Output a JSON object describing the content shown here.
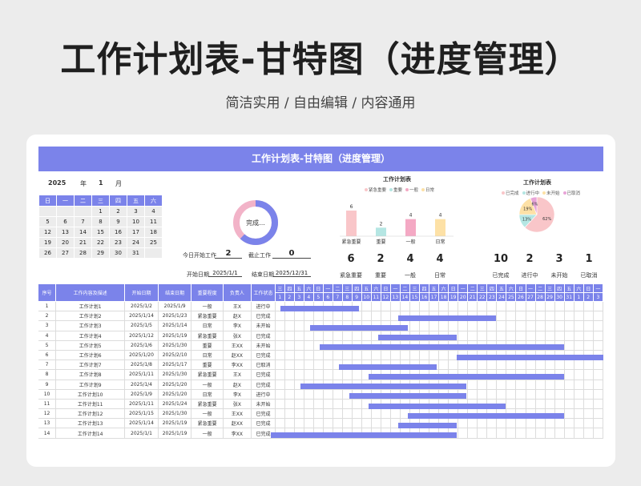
{
  "hero": {
    "title": "工作计划表-甘特图（进度管理）",
    "subtitle": "简洁实用 / 自由编辑 / 内容通用"
  },
  "banner": "工作计划表-甘特图（进度管理）",
  "calendar": {
    "year": "2025",
    "year_unit": "年",
    "month": "1",
    "month_unit": "月",
    "weekdays": [
      "日",
      "一",
      "二",
      "三",
      "四",
      "五",
      "六"
    ],
    "weeks": [
      [
        "",
        "",
        "",
        "1",
        "2",
        "3",
        "4"
      ],
      [
        "5",
        "6",
        "7",
        "8",
        "9",
        "10",
        "11"
      ],
      [
        "12",
        "13",
        "14",
        "15",
        "16",
        "17",
        "18"
      ],
      [
        "19",
        "20",
        "21",
        "22",
        "23",
        "24",
        "25"
      ],
      [
        "26",
        "27",
        "28",
        "29",
        "30",
        "31",
        ""
      ]
    ]
  },
  "status_panel": {
    "donut_label": "完成...",
    "today_start_label": "今日开始工作",
    "today_start_value": "2",
    "due_label": "截止工作",
    "due_value": "0",
    "start_date_label": "开始日期",
    "start_date_value": "2025/1/1",
    "end_date_label": "结束日期",
    "end_date_value": "2025/12/31"
  },
  "bar_chart": {
    "title": "工作计划表",
    "legend": [
      "紧急重要",
      "重要",
      "一般",
      "日常"
    ],
    "colors": [
      "#f9c6c9",
      "#b5e6e3",
      "#f4a9c4",
      "#fde1a6"
    ],
    "categories": [
      "紧急重要",
      "重要",
      "一般",
      "日常"
    ],
    "values": [
      6,
      2,
      4,
      4
    ],
    "counts": [
      "6",
      "2",
      "4",
      "4"
    ]
  },
  "pie_chart": {
    "title": "工作计划表",
    "legend": [
      "已完成",
      "进行中",
      "未开始",
      "已取消"
    ],
    "colors": [
      "#f9c6c9",
      "#b5e6e3",
      "#fde1a6",
      "#e8a4d8"
    ],
    "slices": [
      62,
      13,
      19,
      6
    ],
    "slice_labels": [
      "62%",
      "13%",
      "19%",
      "6%"
    ],
    "counts": [
      "10",
      "2",
      "3",
      "1"
    ],
    "count_labels": [
      "已完成",
      "进行中",
      "未开始",
      "已取消"
    ]
  },
  "gantt": {
    "columns": [
      "序号",
      "工作内容及描述",
      "开始日期",
      "结束日期",
      "重要程度",
      "负责人",
      "工作状态"
    ],
    "weekday_row": [
      "三",
      "四",
      "五",
      "六",
      "日",
      "一",
      "二",
      "三",
      "四",
      "五",
      "六",
      "日",
      "一",
      "二",
      "三",
      "四",
      "五",
      "六",
      "日",
      "一",
      "二",
      "三",
      "四",
      "五",
      "六",
      "日",
      "一",
      "二",
      "三",
      "四",
      "五",
      "六",
      "日",
      "一"
    ],
    "day_row": [
      "1",
      "2",
      "3",
      "4",
      "5",
      "6",
      "7",
      "8",
      "9",
      "10",
      "11",
      "12",
      "13",
      "14",
      "15",
      "16",
      "17",
      "18",
      "19",
      "20",
      "21",
      "22",
      "23",
      "24",
      "25",
      "26",
      "27",
      "28",
      "29",
      "30",
      "31",
      "1",
      "2",
      "3"
    ],
    "rows": [
      [
        "1",
        "工作计划1",
        "2025/1/2",
        "2025/1/9",
        "一般",
        "王X",
        "进行中"
      ],
      [
        "2",
        "工作计划2",
        "2025/1/14",
        "2025/1/23",
        "紧急重要",
        "赵X",
        "已完成"
      ],
      [
        "3",
        "工作计划3",
        "2025/1/5",
        "2025/1/14",
        "日常",
        "李X",
        "未开始"
      ],
      [
        "4",
        "工作计划4",
        "2025/1/12",
        "2025/1/19",
        "紧急重要",
        "张X",
        "已完成"
      ],
      [
        "5",
        "工作计划5",
        "2025/1/6",
        "2025/1/30",
        "重要",
        "王XX",
        "未开始"
      ],
      [
        "6",
        "工作计划6",
        "2025/1/20",
        "2025/2/10",
        "日常",
        "赵XX",
        "已完成"
      ],
      [
        "7",
        "工作计划7",
        "2025/1/8",
        "2025/1/17",
        "重要",
        "李XX",
        "已取消"
      ],
      [
        "8",
        "工作计划8",
        "2025/1/11",
        "2025/1/30",
        "紧急重要",
        "王X",
        "已完成"
      ],
      [
        "9",
        "工作计划9",
        "2025/1/4",
        "2025/1/20",
        "一般",
        "赵X",
        "已完成"
      ],
      [
        "10",
        "工作计划10",
        "2025/1/9",
        "2025/1/20",
        "日常",
        "李X",
        "进行中"
      ],
      [
        "11",
        "工作计划11",
        "2025/1/11",
        "2025/1/24",
        "紧急重要",
        "张X",
        "未开始"
      ],
      [
        "12",
        "工作计划12",
        "2025/1/15",
        "2025/1/30",
        "一般",
        "王XX",
        "已完成"
      ],
      [
        "13",
        "工作计划13",
        "2025/1/14",
        "2025/1/19",
        "紧急重要",
        "赵XX",
        "已完成"
      ],
      [
        "14",
        "工作计划14",
        "2025/1/1",
        "2025/1/19",
        "一般",
        "李XX",
        "已完成"
      ]
    ]
  },
  "colors": {
    "accent": "#7b83ea",
    "calendar_cell": "#ececec"
  }
}
